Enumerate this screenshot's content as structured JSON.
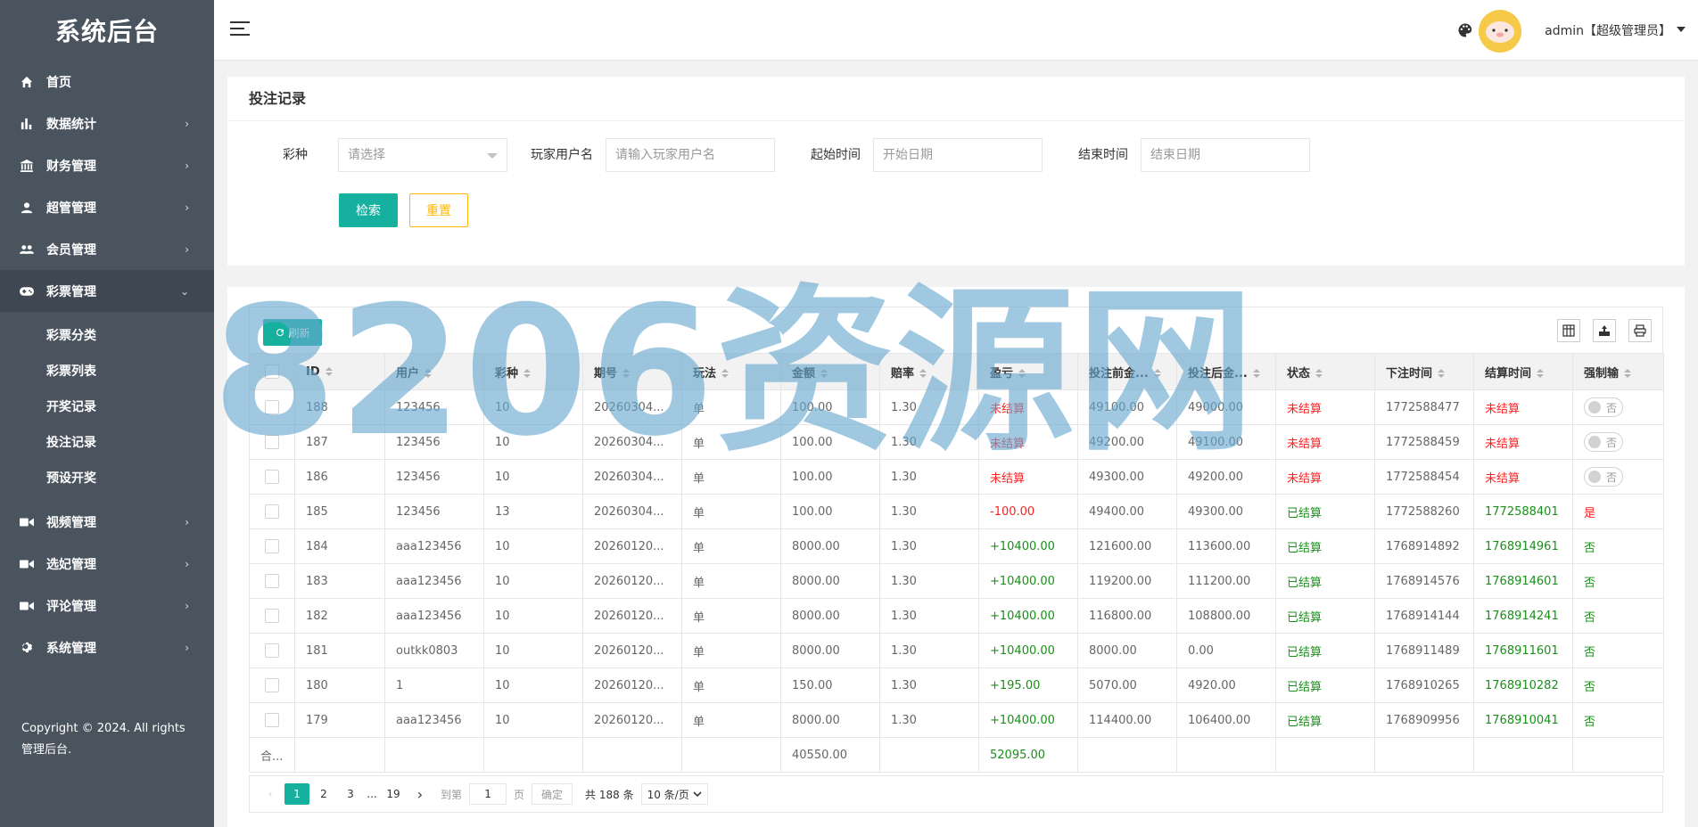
{
  "sidebar": {
    "title": "系统后台",
    "items": [
      {
        "label": "首页",
        "icon": "home-icon",
        "chevron": ""
      },
      {
        "label": "数据统计",
        "icon": "bar-chart-icon",
        "chevron": "›"
      },
      {
        "label": "财务管理",
        "icon": "bank-icon",
        "chevron": "›"
      },
      {
        "label": "超管管理",
        "icon": "user-icon",
        "chevron": "›"
      },
      {
        "label": "会员管理",
        "icon": "users-icon",
        "chevron": "›"
      },
      {
        "label": "彩票管理",
        "icon": "gamepad-icon",
        "chevron": "⌄"
      },
      {
        "label": "视频管理",
        "icon": "video-icon",
        "chevron": "›"
      },
      {
        "label": "选妃管理",
        "icon": "video-icon",
        "chevron": "›"
      },
      {
        "label": "评论管理",
        "icon": "video-icon",
        "chevron": "›"
      },
      {
        "label": "系统管理",
        "icon": "gear-icon",
        "chevron": "›"
      }
    ],
    "sub_items": [
      "彩票分类",
      "彩票列表",
      "开奖记录",
      "投注记录",
      "预设开奖"
    ],
    "copyright": "Copyright © 2024. All rights 管理后台."
  },
  "header": {
    "user": "admin【超级管理员】"
  },
  "search": {
    "title": "投注记录",
    "lottery_label": "彩种",
    "lottery_placeholder": "请选择",
    "user_label": "玩家用户名",
    "user_placeholder": "请输入玩家用户名",
    "start_label": "起始时间",
    "start_placeholder": "开始日期",
    "end_label": "结束时间",
    "end_placeholder": "结束日期",
    "search_btn": "检索",
    "reset_btn": "重置"
  },
  "table": {
    "refresh_btn": "刷新",
    "columns": [
      "ID",
      "用户",
      "彩种",
      "期号",
      "玩法",
      "金额",
      "赔率",
      "盈亏",
      "投注前金...",
      "投注后金...",
      "状态",
      "下注时间",
      "结算时间",
      "强制输"
    ],
    "rows": [
      {
        "id": "188",
        "user": "123456",
        "lottery": "10",
        "period": "20260304...",
        "play": "单",
        "amount": "100.00",
        "odds": "1.30",
        "profit": "未结算",
        "profit_color": "red",
        "before": "49100.00",
        "after": "49000.00",
        "status": "未结算",
        "status_color": "red",
        "bet_time": "1772588477",
        "settle_time": "未结算",
        "settle_color": "red",
        "force": "toggle",
        "force_label": "否"
      },
      {
        "id": "187",
        "user": "123456",
        "lottery": "10",
        "period": "20260304...",
        "play": "单",
        "amount": "100.00",
        "odds": "1.30",
        "profit": "未结算",
        "profit_color": "red",
        "before": "49200.00",
        "after": "49100.00",
        "status": "未结算",
        "status_color": "red",
        "bet_time": "1772588459",
        "settle_time": "未结算",
        "settle_color": "red",
        "force": "toggle",
        "force_label": "否"
      },
      {
        "id": "186",
        "user": "123456",
        "lottery": "10",
        "period": "20260304...",
        "play": "单",
        "amount": "100.00",
        "odds": "1.30",
        "profit": "未结算",
        "profit_color": "red",
        "before": "49300.00",
        "after": "49200.00",
        "status": "未结算",
        "status_color": "red",
        "bet_time": "1772588454",
        "settle_time": "未结算",
        "settle_color": "red",
        "force": "toggle",
        "force_label": "否"
      },
      {
        "id": "185",
        "user": "123456",
        "lottery": "13",
        "period": "20260304...",
        "play": "单",
        "amount": "100.00",
        "odds": "1.30",
        "profit": "-100.00",
        "profit_color": "red",
        "before": "49400.00",
        "after": "49300.00",
        "status": "已结算",
        "status_color": "green",
        "bet_time": "1772588260",
        "settle_time": "1772588401",
        "settle_color": "green",
        "force": "text",
        "force_label": "是",
        "force_color": "red"
      },
      {
        "id": "184",
        "user": "aaa123456",
        "lottery": "10",
        "period": "20260120...",
        "play": "单",
        "amount": "8000.00",
        "odds": "1.30",
        "profit": "+10400.00",
        "profit_color": "green",
        "before": "121600.00",
        "after": "113600.00",
        "status": "已结算",
        "status_color": "green",
        "bet_time": "1768914892",
        "settle_time": "1768914961",
        "settle_color": "green",
        "force": "text",
        "force_label": "否",
        "force_color": "green"
      },
      {
        "id": "183",
        "user": "aaa123456",
        "lottery": "10",
        "period": "20260120...",
        "play": "单",
        "amount": "8000.00",
        "odds": "1.30",
        "profit": "+10400.00",
        "profit_color": "green",
        "before": "119200.00",
        "after": "111200.00",
        "status": "已结算",
        "status_color": "green",
        "bet_time": "1768914576",
        "settle_time": "1768914601",
        "settle_color": "green",
        "force": "text",
        "force_label": "否",
        "force_color": "green"
      },
      {
        "id": "182",
        "user": "aaa123456",
        "lottery": "10",
        "period": "20260120...",
        "play": "单",
        "amount": "8000.00",
        "odds": "1.30",
        "profit": "+10400.00",
        "profit_color": "green",
        "before": "116800.00",
        "after": "108800.00",
        "status": "已结算",
        "status_color": "green",
        "bet_time": "1768914144",
        "settle_time": "1768914241",
        "settle_color": "green",
        "force": "text",
        "force_label": "否",
        "force_color": "green"
      },
      {
        "id": "181",
        "user": "outkk0803",
        "lottery": "10",
        "period": "20260120...",
        "play": "单",
        "amount": "8000.00",
        "odds": "1.30",
        "profit": "+10400.00",
        "profit_color": "green",
        "before": "8000.00",
        "after": "0.00",
        "status": "已结算",
        "status_color": "green",
        "bet_time": "1768911489",
        "settle_time": "1768911601",
        "settle_color": "green",
        "force": "text",
        "force_label": "否",
        "force_color": "green"
      },
      {
        "id": "180",
        "user": "1",
        "lottery": "10",
        "period": "20260120...",
        "play": "单",
        "amount": "150.00",
        "odds": "1.30",
        "profit": "+195.00",
        "profit_color": "green",
        "before": "5070.00",
        "after": "4920.00",
        "status": "已结算",
        "status_color": "green",
        "bet_time": "1768910265",
        "settle_time": "1768910282",
        "settle_color": "green",
        "force": "text",
        "force_label": "否",
        "force_color": "green"
      },
      {
        "id": "179",
        "user": "aaa123456",
        "lottery": "10",
        "period": "20260120...",
        "play": "单",
        "amount": "8000.00",
        "odds": "1.30",
        "profit": "+10400.00",
        "profit_color": "green",
        "before": "114400.00",
        "after": "106400.00",
        "status": "已结算",
        "status_color": "green",
        "bet_time": "1768909956",
        "settle_time": "1768910041",
        "settle_color": "green",
        "force": "text",
        "force_label": "否",
        "force_color": "green"
      }
    ],
    "total_label": "合...",
    "total_amount": "40550.00",
    "total_profit": "52095.00"
  },
  "pager": {
    "pages": [
      "1",
      "2",
      "3",
      "...",
      "19"
    ],
    "goto_label": "到第",
    "goto_value": "1",
    "page_unit": "页",
    "confirm": "确定",
    "total": "共 188 条",
    "page_size": "10 条/页"
  },
  "watermark": "8206资源网"
}
